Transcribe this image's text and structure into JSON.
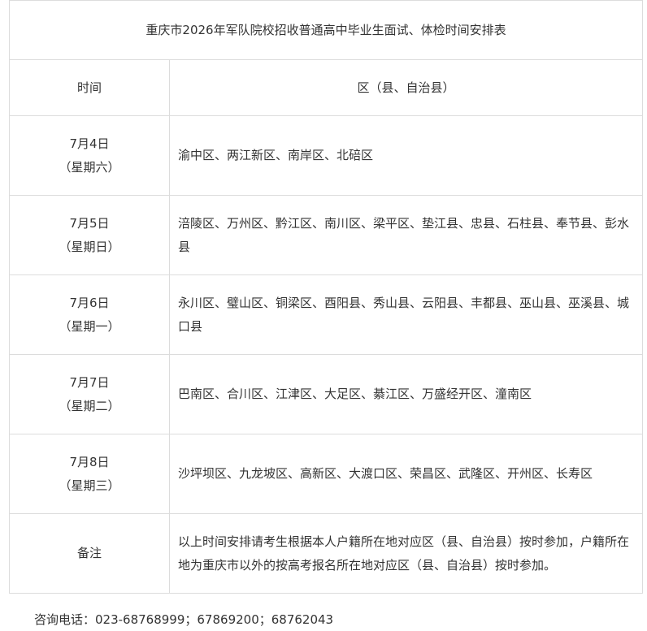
{
  "table": {
    "title": "重庆市2026年军队院校招收普通高中毕业生面试、体检时间安排表",
    "headers": {
      "time": "时间",
      "district": "区（县、自治县）"
    },
    "rows": [
      {
        "date": "7月4日",
        "weekday": "（星期六）",
        "districts": "渝中区、两江新区、南岸区、北碚区"
      },
      {
        "date": "7月5日",
        "weekday": "（星期日）",
        "districts": "涪陵区、万州区、黔江区、南川区、梁平区、垫江县、忠县、石柱县、奉节县、彭水县"
      },
      {
        "date": "7月6日",
        "weekday": "（星期一）",
        "districts": "永川区、璧山区、铜梁区、酉阳县、秀山县、云阳县、丰都县、巫山县、巫溪县、城口县"
      },
      {
        "date": "7月7日",
        "weekday": "（星期二）",
        "districts": "巴南区、合川区、江津区、大足区、綦江区、万盛经开区、潼南区"
      },
      {
        "date": "7月8日",
        "weekday": "（星期三）",
        "districts": "沙坪坝区、九龙坡区、高新区、大渡口区、荣昌区、武隆区、开州区、长寿区"
      }
    ],
    "note": {
      "label": "备注",
      "text": "以上时间安排请考生根据本人户籍所在地对应区（县、自治县）按时参加，户籍所在地为重庆市以外的按高考报名所在地对应区（县、自治县）按时参加。"
    }
  },
  "contact": "咨询电话：023-68768999；67869200；68762043"
}
